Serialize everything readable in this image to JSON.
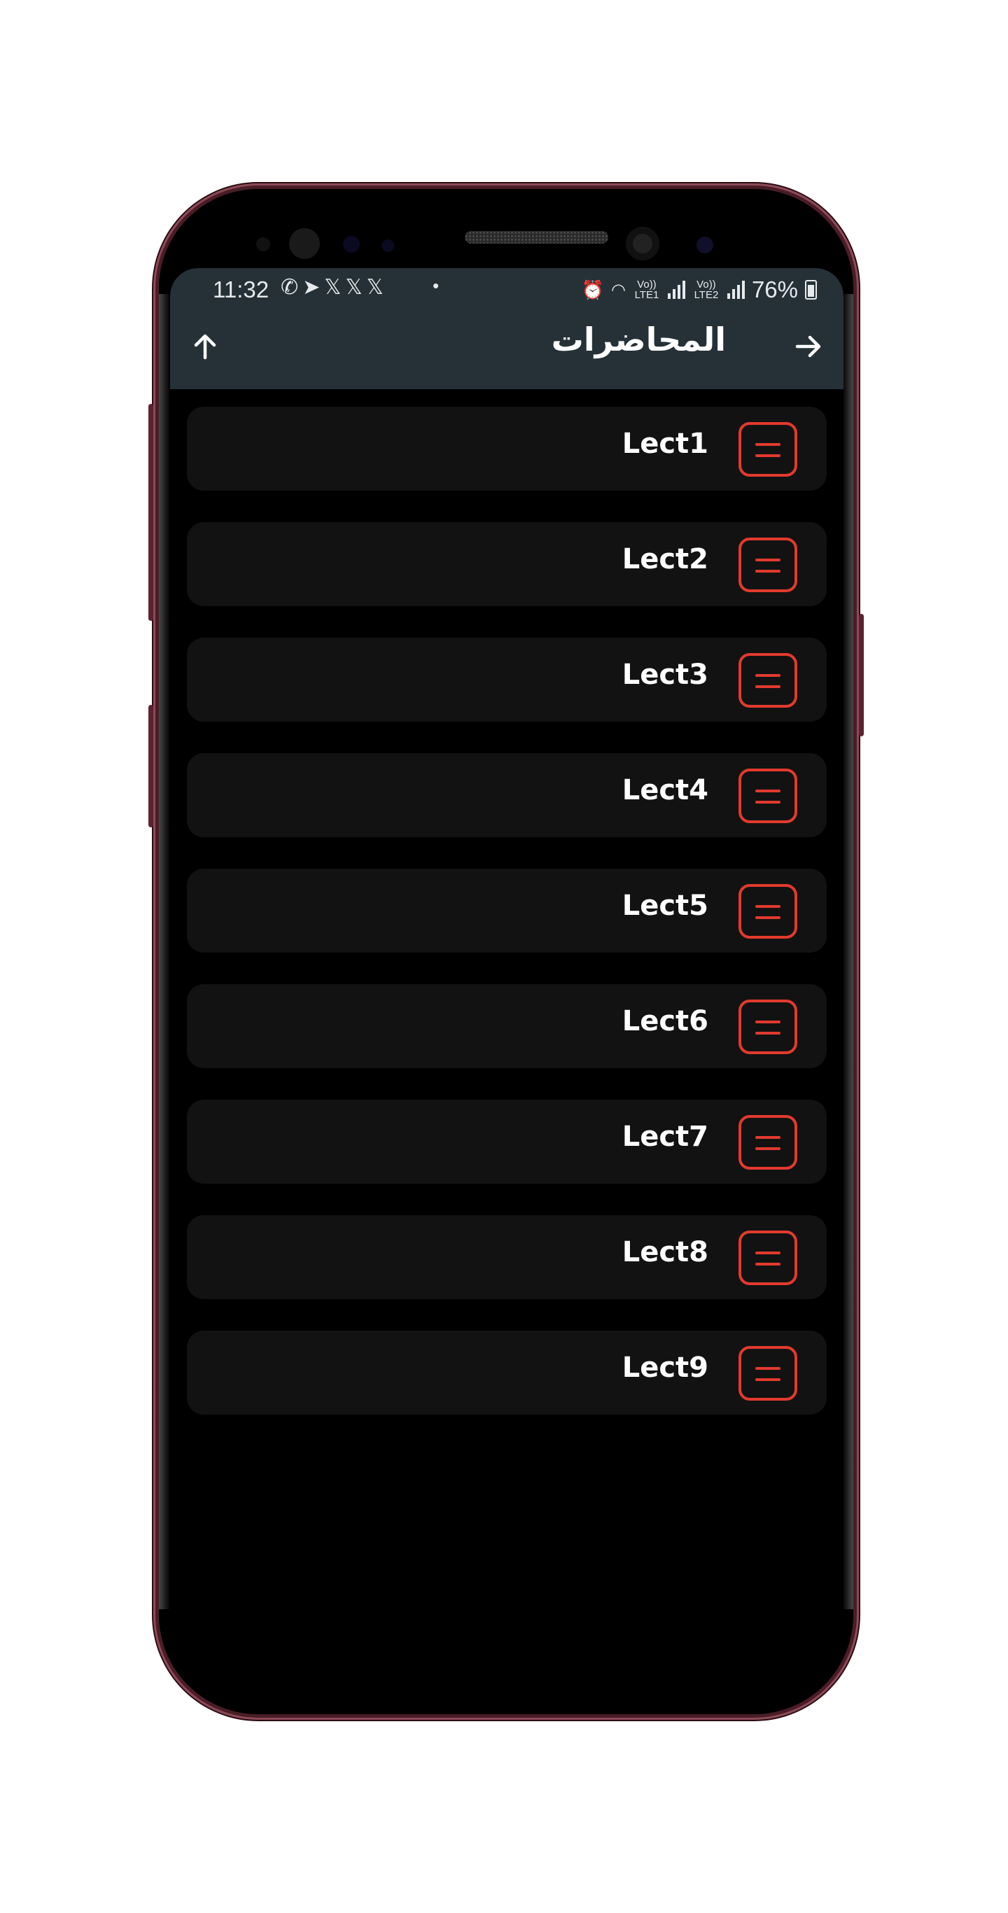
{
  "status_bar": {
    "time": "11:32",
    "notifications": [
      "whatsapp-icon",
      "telegram-icon",
      "x-icon",
      "x-icon",
      "x-icon"
    ],
    "dot": "•",
    "sim1": "Vo)) LTE1",
    "sim2": "Vo)) LTE2",
    "battery": "76%"
  },
  "app_bar": {
    "title": "المحاضرات",
    "left_icon": "arrow-up-icon",
    "right_icon": "arrow-right-icon",
    "background": "#263137"
  },
  "lectures": [
    {
      "label": "Lect1"
    },
    {
      "label": "Lect2"
    },
    {
      "label": "Lect3"
    },
    {
      "label": "Lect4"
    },
    {
      "label": "Lect5"
    },
    {
      "label": "Lect6"
    },
    {
      "label": "Lect7"
    },
    {
      "label": "Lect8"
    },
    {
      "label": "Lect9"
    }
  ],
  "colors": {
    "accent": "#e23a2e",
    "item_background": "#121212",
    "screen_background": "#000000"
  }
}
